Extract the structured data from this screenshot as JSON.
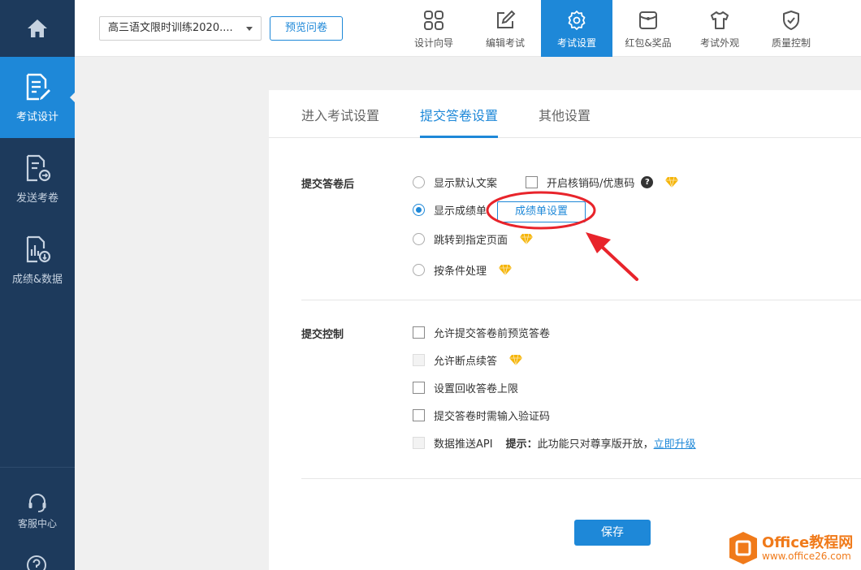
{
  "sidebar": {
    "items": [
      {
        "label": "考试设计",
        "icon": "edit-document-icon",
        "active": true
      },
      {
        "label": "发送考卷",
        "icon": "send-document-icon",
        "active": false
      },
      {
        "label": "成绩&数据",
        "icon": "report-data-icon",
        "active": false
      }
    ],
    "service_label": "客服中心"
  },
  "topbar": {
    "survey_name": "高三语文限时训练2020....",
    "preview_label": "预览问卷",
    "tabs": [
      {
        "label": "设计向导",
        "icon": "grid-icon"
      },
      {
        "label": "编辑考试",
        "icon": "pencil-icon"
      },
      {
        "label": "考试设置",
        "icon": "gear-icon",
        "active": true
      },
      {
        "label": "红包&奖品",
        "icon": "gift-bag-icon"
      },
      {
        "label": "考试外观",
        "icon": "tshirt-icon"
      },
      {
        "label": "质量控制",
        "icon": "shield-check-icon"
      }
    ]
  },
  "subtabs": [
    {
      "label": "进入考试设置"
    },
    {
      "label": "提交答卷设置",
      "active": true
    },
    {
      "label": "其他设置"
    }
  ],
  "after_submit": {
    "label": "提交答卷后",
    "options": [
      {
        "label": "显示默认文案",
        "checked": false
      },
      {
        "label": "显示成绩单",
        "checked": true
      },
      {
        "label": "跳转到指定页面",
        "checked": false
      },
      {
        "label": "按条件处理",
        "checked": false
      }
    ],
    "coupon_label": "开启核销码/优惠码",
    "score_settings_label": "成绩单设置"
  },
  "submit_control": {
    "label": "提交控制",
    "options": [
      {
        "label": "允许提交答卷前预览答卷",
        "disabled": false
      },
      {
        "label": "允许断点续答",
        "disabled": true
      },
      {
        "label": "设置回收答卷上限",
        "disabled": false
      },
      {
        "label": "提交答卷时需输入验证码",
        "disabled": false
      },
      {
        "label": "数据推送API",
        "disabled": true
      }
    ],
    "hint_prefix": "提示：",
    "hint_text": "此功能只对尊享版开放，",
    "upgrade_link": "立即升级"
  },
  "save_label": "保存",
  "watermark": {
    "line1": "Office教程网",
    "line2": "www.office26.com"
  },
  "colors": {
    "accent": "#1e88d8",
    "sidebar": "#1d3a5c",
    "gem": "#f5b50a",
    "annotation": "#e8242b"
  }
}
